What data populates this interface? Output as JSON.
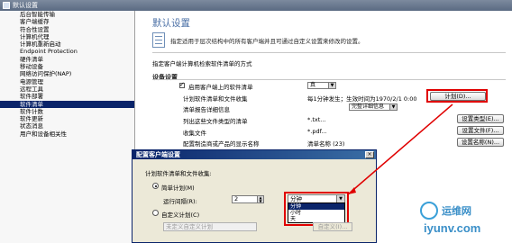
{
  "window": {
    "title": "默认设置"
  },
  "sidebar": {
    "items": [
      {
        "label": "后台智能传输",
        "selected": false
      },
      {
        "label": "客户端缓存",
        "selected": false
      },
      {
        "label": "符合性设置",
        "selected": false
      },
      {
        "label": "计算机代理",
        "selected": false
      },
      {
        "label": "计算机重新启动",
        "selected": false
      },
      {
        "label": "Endpoint Protection",
        "selected": false
      },
      {
        "label": "硬件清单",
        "selected": false
      },
      {
        "label": "移动设备",
        "selected": false
      },
      {
        "label": "网络访问保护(NAP)",
        "selected": false
      },
      {
        "label": "电源管理",
        "selected": false
      },
      {
        "label": "远程工具",
        "selected": false
      },
      {
        "label": "软件部署",
        "selected": false
      },
      {
        "label": "软件清单",
        "selected": true
      },
      {
        "label": "软件计数",
        "selected": false
      },
      {
        "label": "软件更新",
        "selected": false
      },
      {
        "label": "状态消息",
        "selected": false
      },
      {
        "label": "用户和设备相关性",
        "selected": false
      }
    ]
  },
  "main": {
    "title": "默认设置",
    "description": "指定适用于层次结构中的所有客户端并且可通过自定义设置来修改的设置。",
    "schedule_caption": "指定客户端计算机检索软件清单的方式",
    "device_settings_header": "设备设置",
    "rows": [
      {
        "label": "启用客户端上的软件清单",
        "value": "真",
        "checked": true
      },
      {
        "label": "计划软件清单和文件收集",
        "value": "每1分钟发生；生效时间为1970/2/1 0:00",
        "button": "计划(D)..."
      },
      {
        "label": "清单报告详细信息",
        "value": "完整详细信息"
      },
      {
        "label": "列出这些文件类型的清单",
        "value": "*.txt...",
        "button": "设置类型(E)..."
      },
      {
        "label": "收集文件",
        "value": "*.pdf...",
        "button": "设置文件(F)..."
      },
      {
        "label": "配置制造商或产品的显示名称",
        "value": "清单名称 (23)",
        "button": "设置名称(N)..."
      }
    ]
  },
  "dialog": {
    "title": "配置客户端设置",
    "section_label": "计划软件清单和文件收集:",
    "simple_schedule_label": "简单计划(M)",
    "run_interval_label": "运行间隔(R):",
    "interval_value": "2",
    "unit_selected": "分钟",
    "unit_options": [
      "分钟",
      "小时",
      "天"
    ],
    "custom_schedule_label": "自定义计划(C)",
    "no_custom_schedule": "未定义自定义计划",
    "customize_button": "自定义(I)..."
  },
  "colors": {
    "accent": "#0a246a",
    "highlight": "#e00000",
    "title_blue": "#4a6fa5",
    "dialog_bg": "#ece9d8"
  },
  "watermark": {
    "text_cn": "运维网",
    "text_en": "iyunv.com"
  }
}
